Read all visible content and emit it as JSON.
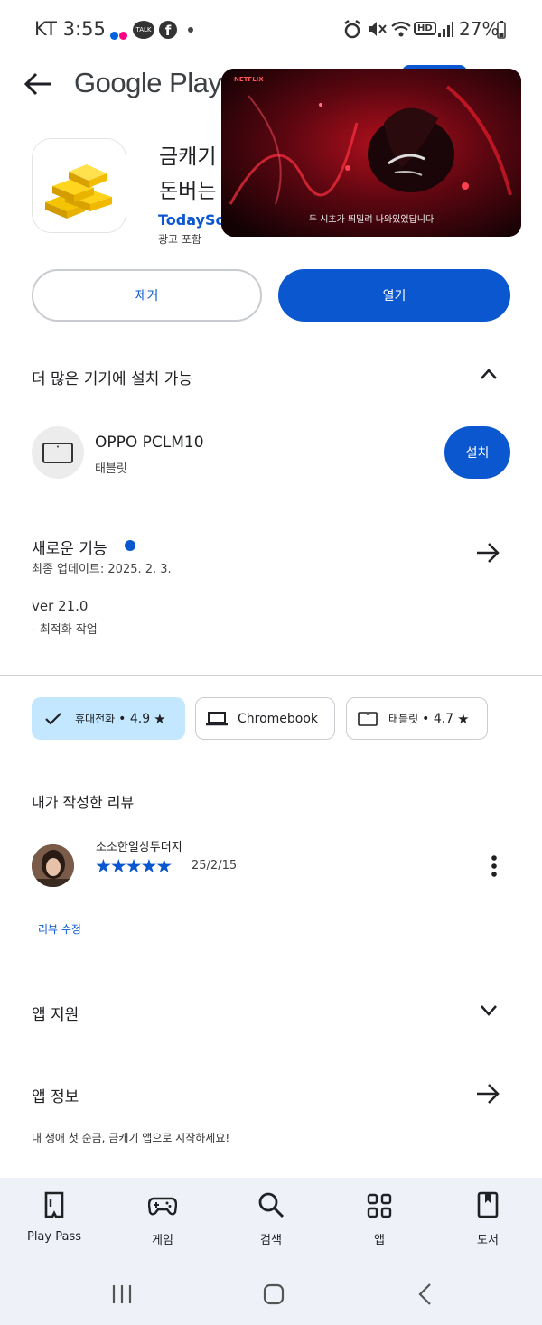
{
  "status_bar": {
    "carrier_time": "KT 3:55",
    "battery": "27%"
  },
  "header": {
    "brand": "Google Play"
  },
  "app": {
    "title_line1": "금캐기",
    "title_line2": "돈버는",
    "developer": "TodaySof",
    "ads_label": "광고 포함"
  },
  "video": {
    "subtitle": "두 시초가 띄밀려 나와있었답니다"
  },
  "actions": {
    "uninstall_label": "제거",
    "open_label": "열기"
  },
  "more_devices": {
    "title": "더 많은 기기에 설치 가능",
    "device_name": "OPPO PCLM10",
    "device_type": "태블릿",
    "install_label": "설치"
  },
  "whats_new": {
    "title": "새로운 기능",
    "updated": "최종 업데이트: 2025. 2. 3.",
    "version": "ver 21.0",
    "note": "- 최적화 작업"
  },
  "device_chips": [
    {
      "label": "휴대전화",
      "rating": "• 4.9"
    },
    {
      "label": "Chromebook",
      "rating": ""
    },
    {
      "label": "태블릿",
      "rating": "• 4.7"
    }
  ],
  "my_review": {
    "title": "내가 작성한 리뷰",
    "reviewer": "소소한일상두더지",
    "stars": 5,
    "date": "25/2/15",
    "edit_label": "리뷰 수정"
  },
  "app_support": {
    "title": "앱 지원"
  },
  "app_info": {
    "title": "앱 정보",
    "description": "내 생애 첫 순금, 금캐기 앱으로 시작하세요!"
  },
  "bottom_nav": [
    {
      "label": "Play Pass",
      "icon": "play-pass-icon"
    },
    {
      "label": "게임",
      "icon": "gamepad-icon"
    },
    {
      "label": "검색",
      "icon": "search-icon"
    },
    {
      "label": "앱",
      "icon": "apps-grid-icon"
    },
    {
      "label": "도서",
      "icon": "book-icon"
    }
  ],
  "colors": {
    "accent": "#0b57d0",
    "chip_selected": "#c2e7ff",
    "nav_bg": "#eef1f7"
  }
}
